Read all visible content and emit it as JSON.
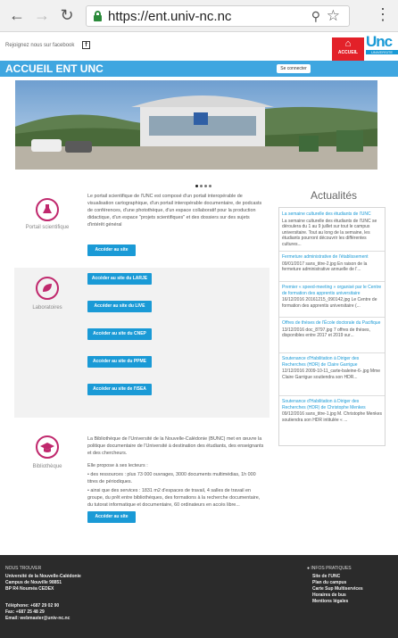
{
  "browser": {
    "url": "https://ent.univ-nc.nc"
  },
  "topbar": {
    "facebook_text": "Rejoignez nous sur facebook",
    "accueil_label": "ACCUEIL",
    "logo_text": "Unc",
    "logo_sub": "UNIVERSITE"
  },
  "header": {
    "title": "ACCUEIL ENT UNC",
    "login_label": "Se connecter"
  },
  "portail": {
    "label": "Portail scientifique",
    "text": "Le portail scientifique de l'UNC est composé d'un portail interopérable de visualisation cartographique, d'un portail interopérable documentaire, de podcasts de conférences, d'une photothèque, d'un espace collaboratif pour la production didactique, d'un espace \"projets scientifiques\" et des dossiers sur des sujets d'intérêt général",
    "button": "Accéder au site"
  },
  "labos": {
    "label": "Laboratoires",
    "buttons": [
      "Accéder au site du LARJE",
      "Accéder au site du LIVE",
      "Accéder au site du CNEP",
      "Accéder au site du PPME",
      "Accéder au site de l'ISEA"
    ]
  },
  "biblio": {
    "label": "Bibliothèque",
    "intro": "La Bibliothèque de l'Université de la Nouvelle-Calédonie (BUNC) met en œuvre la politique documentaire de l'Université à destination des étudiants, des enseignants et des chercheurs.",
    "propose": "Elle propose à ses lecteurs :",
    "bullet1": "des ressources : plus 73 000 ouvrages, 3000 documents multimédias, 1h 000 titres de périodiques.",
    "bullet2": "ainsi que des services : 1831 m2 d'espaces de travail, 4 salles de travail en groupe, du prêt entre bibliothèques, des formations à la recherche documentaire, du tutorat informatique et documentaire, 60 ordinateurs en accès libre...",
    "button": "Accéder au site"
  },
  "news": {
    "title": "Actualités",
    "items": [
      {
        "title": "La semaine culturelle des étudiants de l'UNC",
        "desc": "La semaine culturelle des étudiants de l'UNC se déroulera du 1 au 9 juillet sur tout le campus universitaire. Tout au long de la semaine, les étudiants pourront découvrir les différentes cultures..."
      },
      {
        "title": "Fermeture administrative de l'établissement",
        "desc": "09/01/2017 sans_titre-2.jpg En raison de la fermeture administrative annuelle de l'..."
      },
      {
        "title": "Premier « speed-meeting » organisé par le Centre de formation des apprentis universitaire",
        "desc": "16/12/2016 20161215_090142.jpg Le Centre de formation des apprentis universitaire (..."
      },
      {
        "title": "Offres de thèses de l'École doctorale du Pacifique",
        "desc": "13/12/2016 doc_8797.jpg 7 offres de thèses, disponibles entre 2017 et 2019 sur..."
      },
      {
        "title": "Soutenance d'Habilitation à Diriger des Recherches (HDR) de Claire Garrigue",
        "desc": "12/12/2016 2009-10-11_carte-baleine-6-.jpg Mme Claire Garrigue soutiendra son HDR..."
      },
      {
        "title": "Soutenance d'Habilitation à Diriger des Recherches (HDR) de Christophe Menkes",
        "desc": "09/12/2016 sans_titre-1.jpg M. Christophe Menkes soutiendra son HDR intitulée « ..."
      }
    ]
  },
  "footer": {
    "find_us_heading": "NOUS TROUVER",
    "find_us_lines": [
      "Université de la Nouvelle-Calédonie",
      "Campus de Nouville 98851",
      "BP R4 Nouméa CEDEX"
    ],
    "contact_lines": [
      "Téléphone: +687 29 02 90",
      "Fax: +687 25 48 29",
      "Email: webmaster@univ-nc.nc"
    ],
    "info_heading": "INFOS PRATIQUES",
    "info_lines": [
      "Site de l'UNC",
      "Plan du campus",
      "Carte Sup Multiservices",
      "Horaires de bus",
      "Mentions légales"
    ]
  }
}
